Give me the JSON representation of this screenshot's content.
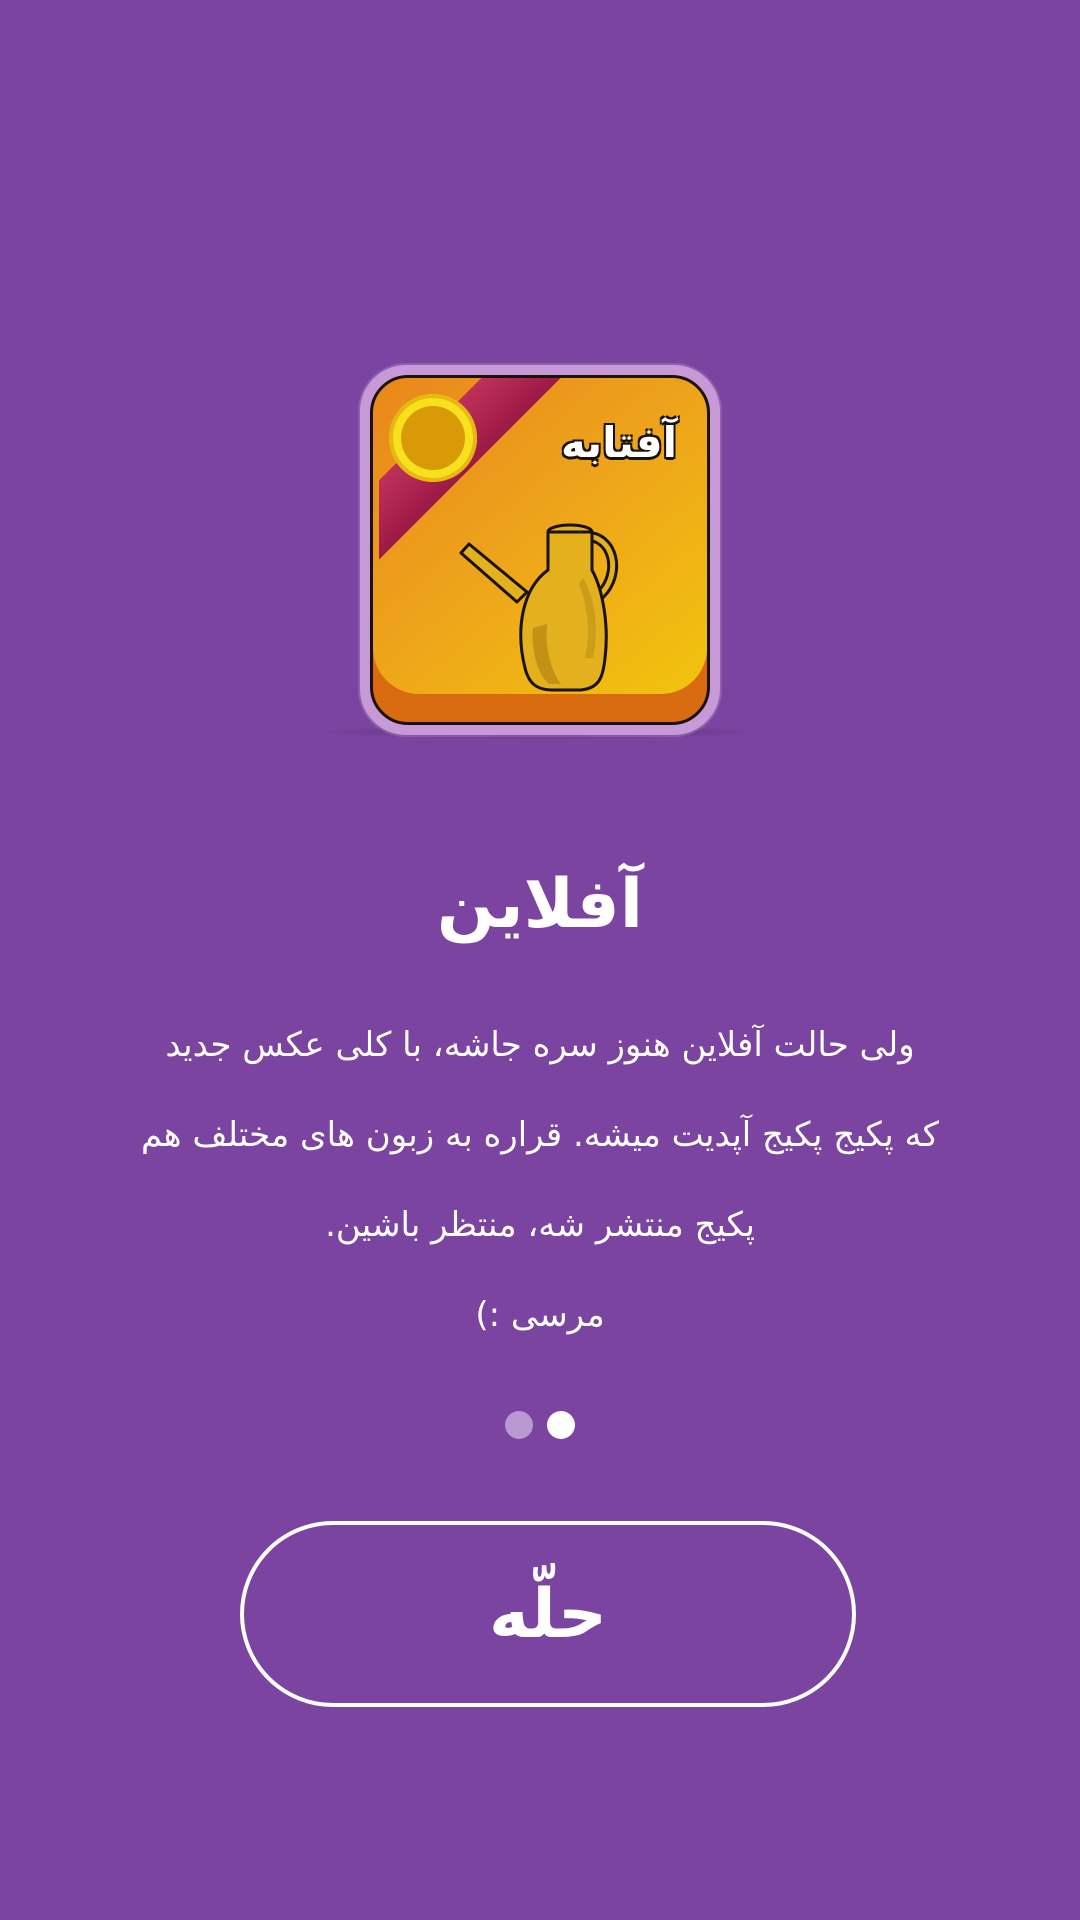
{
  "card": {
    "label": "آفتابه",
    "image_icon": "water-jug-icon",
    "coin_icon": "coin-icon",
    "colors": {
      "face_start": "#e9871b",
      "face_end": "#f2c40d",
      "ribbon": "#b0244f",
      "coin": "#f6e11c"
    }
  },
  "title": "آفلاین",
  "body": {
    "lines": [
      "ولی حالت آفلاین هنوز سره جاشه، با کلی عکس جدید",
      "که پکیج پکیج آپدیت میشه. قراره به زبون های مختلف هم",
      "پکیج منتشر شه، منتظر باشین."
    ],
    "thanks": "مرسی :)"
  },
  "pager": {
    "total": 2,
    "active_index": 1
  },
  "cta": {
    "label": "حلّه"
  },
  "colors": {
    "background": "#7a44a0",
    "text": "#ffffff",
    "dot_inactive": "#b798d0",
    "dot_active": "#ffffff"
  }
}
